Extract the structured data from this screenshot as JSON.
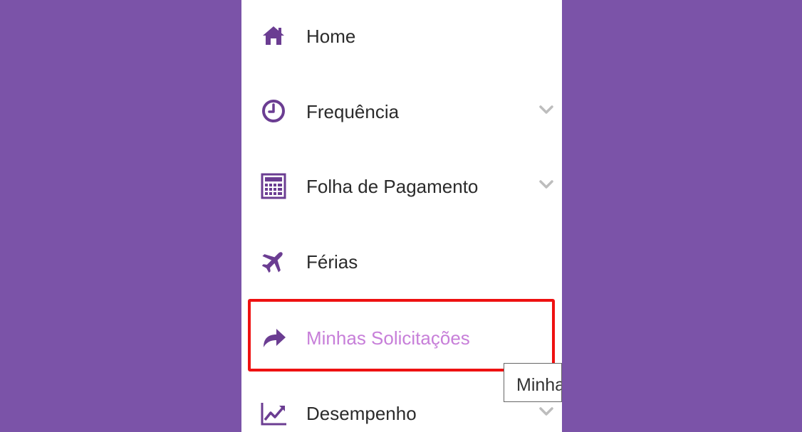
{
  "theme": {
    "background": "#7b53a8",
    "panel": "#ffffff",
    "icon_color": "#6b3d92",
    "active_color": "#c77fd9",
    "highlight_border": "#ee1111",
    "chevron_color": "#bdbdbd"
  },
  "menu": {
    "items": [
      {
        "label": "Home",
        "icon": "home-icon",
        "has_submenu": false
      },
      {
        "label": "Frequência",
        "icon": "clock-icon",
        "has_submenu": true
      },
      {
        "label": "Folha de Pagamento",
        "icon": "calculator-icon",
        "has_submenu": true
      },
      {
        "label": "Férias",
        "icon": "airplane-icon",
        "has_submenu": false
      },
      {
        "label": "Minhas Solicitações",
        "icon": "share-arrow-icon",
        "has_submenu": false,
        "active": true
      },
      {
        "label": "Desempenho",
        "icon": "line-chart-icon",
        "has_submenu": true
      }
    ]
  },
  "tooltip": {
    "text": "Minhas Solicitações"
  }
}
